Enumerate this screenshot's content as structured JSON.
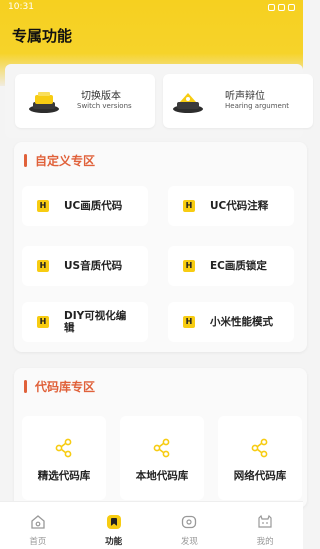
{
  "status_bar": {
    "time": "10:31"
  },
  "header": {
    "title": "专属功能"
  },
  "version": {
    "items": [
      {
        "title": "切换版本",
        "subtitle": "Switch versions",
        "icon": "switch-version-icon"
      },
      {
        "title": "听声辩位",
        "subtitle": "Hearing argument",
        "icon": "hearing-icon"
      }
    ]
  },
  "custom_section": {
    "title": "自定义专区",
    "items": [
      {
        "label": "UC画质代码"
      },
      {
        "label": "UC代码注释"
      },
      {
        "label": "US音质代码"
      },
      {
        "label": "EC画质锁定"
      },
      {
        "label": "DIY可视化编辑"
      },
      {
        "label": "小米性能模式"
      }
    ],
    "badge_glyph": "H"
  },
  "code_library": {
    "title": "代码库专区",
    "items": [
      {
        "label": "精选代码库",
        "icon": "share-icon"
      },
      {
        "label": "本地代码库",
        "icon": "share-icon"
      },
      {
        "label": "网络代码库",
        "icon": "share-icon"
      }
    ]
  },
  "bottom_nav": {
    "items": [
      {
        "label": "首页",
        "icon": "home-icon"
      },
      {
        "label": "功能",
        "icon": "function-icon",
        "active": true
      },
      {
        "label": "发现",
        "icon": "discover-icon"
      },
      {
        "label": "我的",
        "icon": "profile-icon"
      }
    ]
  },
  "colors": {
    "accent": "#f6d020",
    "section_title": "#e0613a",
    "icon_yellow": "#f7cc12"
  }
}
